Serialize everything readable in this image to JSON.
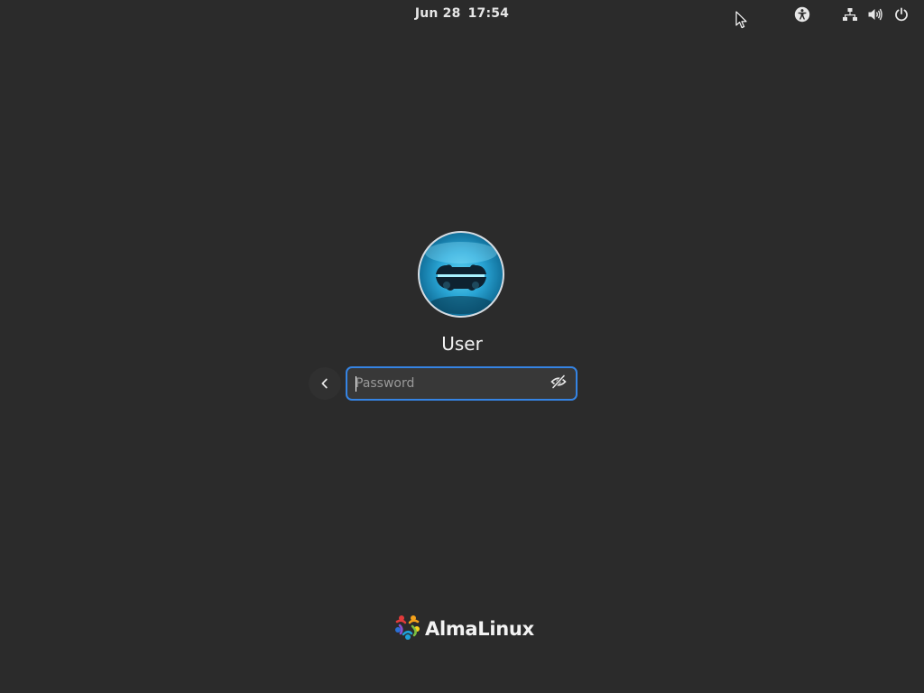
{
  "topbar": {
    "date": "Jun 28",
    "time": "17:54",
    "icons": [
      "accessibility-icon",
      "network-wired-icon",
      "volume-icon",
      "power-icon"
    ]
  },
  "login": {
    "username": "User",
    "password_placeholder": "Password",
    "password_value": "",
    "back_icon": "chevron-left-icon",
    "reveal_icon": "eye-hidden-icon"
  },
  "branding": {
    "logo_text": "AlmaLinux"
  },
  "colors": {
    "background": "#2b2b2b",
    "accent": "#3584e4",
    "text": "#ffffff"
  }
}
